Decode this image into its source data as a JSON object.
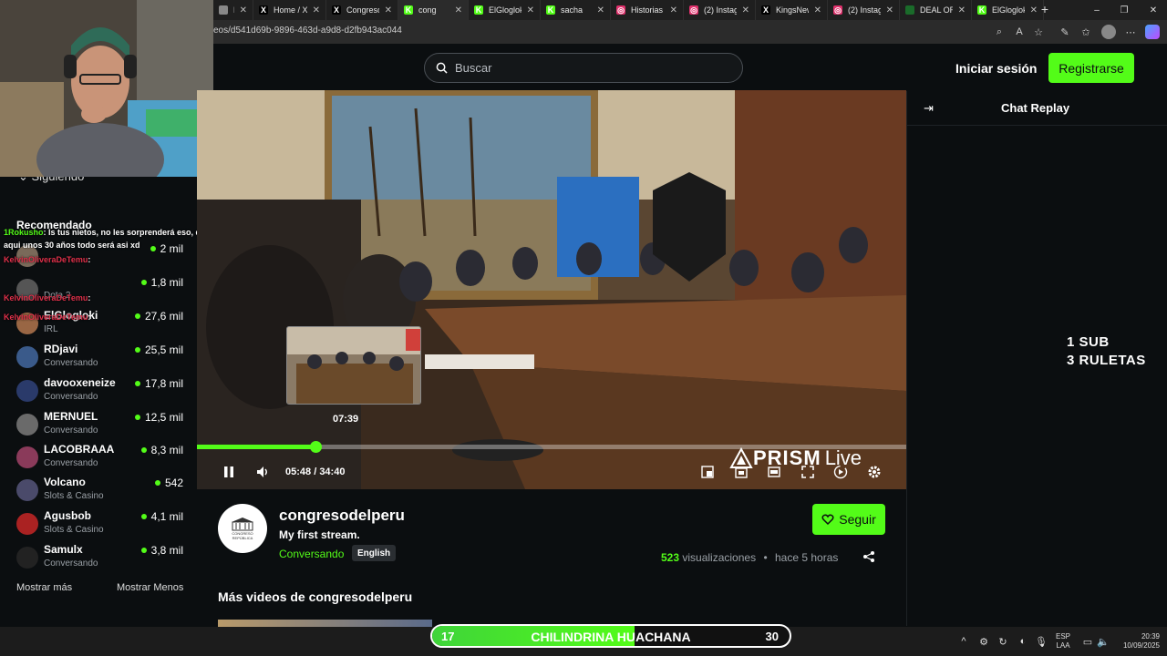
{
  "browser": {
    "tabs": [
      {
        "icon": "h",
        "color": "#888888",
        "title": "Ha"
      },
      {
        "icon": "x-icon",
        "color": "#000000",
        "title": "Home / X"
      },
      {
        "icon": "x-icon",
        "color": "#000000",
        "title": "Congreso"
      },
      {
        "icon": "kick-icon",
        "color": "#53fc18",
        "title": "cong"
      },
      {
        "icon": "kick-icon",
        "color": "#53fc18",
        "title": "ElGlogloki"
      },
      {
        "icon": "kick-icon",
        "color": "#53fc18",
        "title": "sacha"
      },
      {
        "icon": "instagram-icon",
        "color": "#e1306c",
        "title": "Historias -"
      },
      {
        "icon": "instagram-icon",
        "color": "#e1306c",
        "title": "(2) Instagr"
      },
      {
        "icon": "x-icon",
        "color": "#000000",
        "title": "KingsNew"
      },
      {
        "icon": "instagram-icon",
        "color": "#e1306c",
        "title": "(2) Instagr"
      },
      {
        "icon": "app-icon",
        "color": "#1a6b2a",
        "title": "DEAL OR"
      },
      {
        "icon": "kick-icon",
        "color": "#53fc18",
        "title": "ElGlogloki"
      }
    ],
    "url": "eos/d541d69b-9896-463d-a9d8-d2fb943ac044"
  },
  "header": {
    "search_placeholder": "Buscar",
    "login_label": "Iniciar sesión",
    "register_label": "Registrarse"
  },
  "sidebar": {
    "following_label": "Siguiendo",
    "recommended_label": "Recomendado",
    "channels": [
      {
        "name": "",
        "category": "",
        "viewers": "2 mil",
        "color": "#7a6a5a"
      },
      {
        "name": "",
        "category": "Dota 2",
        "viewers": "1,8 mil",
        "color": "#555555"
      },
      {
        "name": "ElGlogloki",
        "category": "IRL",
        "viewers": "27,6 mil",
        "color": "#996644"
      },
      {
        "name": "RDjavi",
        "category": "Conversando",
        "viewers": "25,5 mil",
        "color": "#3a5a8a"
      },
      {
        "name": "davooxeneize",
        "category": "Conversando",
        "viewers": "17,8 mil",
        "color": "#2a3a6a"
      },
      {
        "name": "MERNUEL",
        "category": "Conversando",
        "viewers": "12,5 mil",
        "color": "#6a6a6a"
      },
      {
        "name": "LACOBRAAA",
        "category": "Conversando",
        "viewers": "8,3 mil",
        "color": "#8a3a5a"
      },
      {
        "name": "Volcano",
        "category": "Slots & Casino",
        "viewers": "542",
        "color": "#4a4a6a"
      },
      {
        "name": "Agusbob",
        "category": "Slots & Casino",
        "viewers": "4,1 mil",
        "color": "#aa2222"
      },
      {
        "name": "Samulx",
        "category": "Conversando",
        "viewers": "3,8 mil",
        "color": "#222222"
      }
    ],
    "show_more": "Mostrar más",
    "show_less": "Mostrar Menos"
  },
  "chat_overlay": {
    "lines": [
      {
        "user": "1Rokusho",
        "text": ": ls tus nietos, no les sorprenderá eso, de",
        "color": "#53fc18"
      },
      {
        "user": "",
        "text": "aqui unos 30 años todo será asi xd",
        "color": "#ffffff"
      },
      {
        "user": "KelvinOliveraDeTemu",
        "text": ":",
        "color": "#e0304a"
      },
      {
        "user": "KelvinOliveraDeTemu",
        "text": ":",
        "color": "#e0304a"
      },
      {
        "user": "KelvinOliveraDeTemu",
        "text": ":",
        "color": "#e0304a"
      }
    ]
  },
  "video": {
    "hover_time": "07:39",
    "current_time": "05:48",
    "duration": "34:40",
    "progress_fraction": 0.1673,
    "watermark_brand": "PRISM",
    "watermark_suffix": "Live",
    "progress_color": "#53fc18"
  },
  "channel": {
    "name": "congresodelperu",
    "avatar_text": "CONGRESO REPÚBLICA",
    "stream_title": "My first stream.",
    "category": "Conversando",
    "language": "English",
    "follow_label": "Seguir",
    "views_count": "523",
    "views_label": "visualizaciones",
    "time_ago": "hace 5 horas"
  },
  "more_videos_title": "Más videos de congresodelperu",
  "chat_panel": {
    "title": "Chat Replay"
  },
  "promo": {
    "line1": "1 SUB",
    "line2": "3 RULETAS"
  },
  "goal_bar": {
    "left": "17",
    "label": "CHILINDRINA HUACHANA",
    "right": "30",
    "progress_fraction": 0.567
  },
  "taskbar": {
    "lang_line1": "ESP",
    "lang_line2": "LAA",
    "time": "20:39",
    "date": "10/09/2025"
  },
  "colors": {
    "accent": "#53fc18",
    "background": "#0b0e10"
  }
}
